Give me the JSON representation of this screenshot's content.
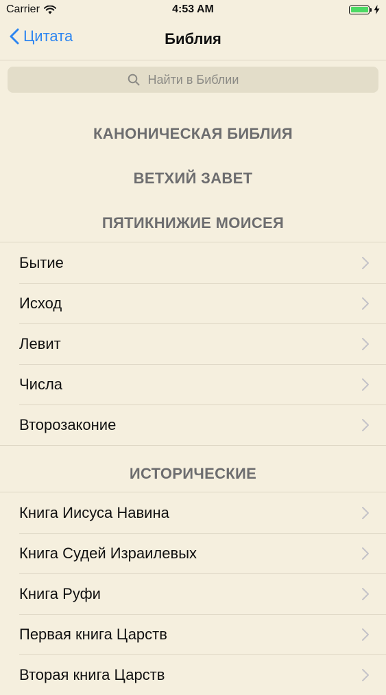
{
  "status_bar": {
    "carrier": "Carrier",
    "time": "4:53 AM"
  },
  "nav": {
    "back_label": "Цитата",
    "title": "Библия"
  },
  "search": {
    "placeholder": "Найти в Библии"
  },
  "headings": {
    "canonical": "КАНОНИЧЕСКАЯ БИБЛИЯ",
    "old_testament": "ВЕТХИЙ ЗАВЕТ",
    "pentateuch": "ПЯТИКНИЖИЕ МОИСЕЯ",
    "historical": "ИСТОРИЧЕСКИЕ"
  },
  "pentateuch_books": [
    {
      "label": "Бытие"
    },
    {
      "label": "Исход"
    },
    {
      "label": "Левит"
    },
    {
      "label": "Числа"
    },
    {
      "label": "Второзаконие"
    }
  ],
  "historical_books": [
    {
      "label": "Книга Иисуса Навина"
    },
    {
      "label": "Книга Судей Израилевых"
    },
    {
      "label": "Книга Руфи"
    },
    {
      "label": "Первая книга Царств"
    },
    {
      "label": "Вторая книга Царств"
    }
  ],
  "colors": {
    "background": "#f5efde",
    "accent": "#2e86f0",
    "heading": "#6d6d6f",
    "battery": "#4cd964"
  }
}
